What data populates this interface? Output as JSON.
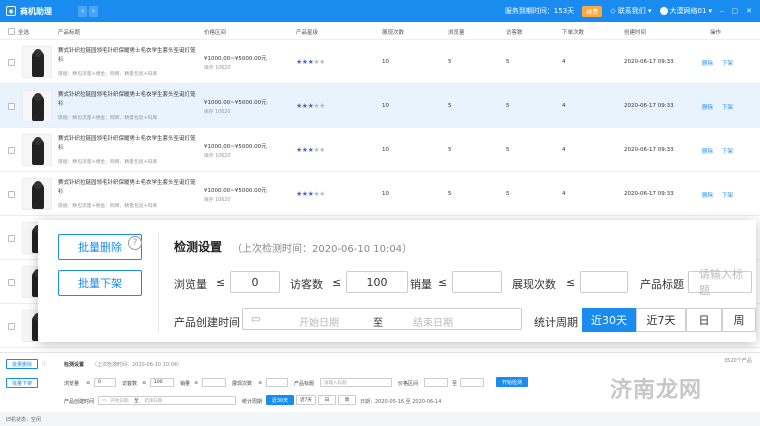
{
  "topbar": {
    "app_title": "商机助理",
    "back": "‹",
    "forward": "›",
    "expiry": "服务到期时间：153天",
    "renew": "续费",
    "contact": "联系我们",
    "user": "大漠网络01",
    "min": "–",
    "max": "▢",
    "close": "✕"
  },
  "table": {
    "headers": [
      "全选",
      "产品标题",
      "价格区间",
      "产品星级",
      "展现次数",
      "浏览量",
      "访客数",
      "下单次数",
      "创建时间",
      "操作"
    ],
    "rows": [
      {
        "title": "赛式针织拉链园领毛针织保暖男士毛衣学生套头圣诞灯笼衫",
        "sub": "旗舰：精包流量+佣金、网商、精量包退+码库",
        "price": "¥1000.00~¥5000.00元",
        "stock": "库存 10620",
        "stars": 3,
        "shows": "10",
        "views": "5",
        "visitors": "5",
        "orders": "4",
        "created": "2020-06-17 09:33",
        "del": "删除",
        "off": "下架"
      },
      {
        "title": "赛式针织拉链园领毛针织保暖男士毛衣学生套头圣诞灯笼衫",
        "sub": "旗舰：精包流量+佣金、网商、精量包退+码库",
        "price": "¥1000.00~¥5000.00元",
        "stock": "库存 10620",
        "stars": 3,
        "shows": "10",
        "views": "5",
        "visitors": "5",
        "orders": "4",
        "created": "2020-06-17 09:33",
        "del": "删除",
        "off": "下架"
      },
      {
        "title": "赛式针织拉链园领毛针织保暖男士毛衣学生套头圣诞灯笼衫",
        "sub": "旗舰：精包流量+佣金、网商、精量包退+码库",
        "price": "¥1000.00~¥5000.00元",
        "stock": "库存 10620",
        "stars": 3,
        "shows": "10",
        "views": "5",
        "visitors": "5",
        "orders": "4",
        "created": "2020-06-17 09:33",
        "del": "删除",
        "off": "下架"
      },
      {
        "title": "赛式针织拉链园领毛针织保暖男士毛衣学生套头圣诞灯笼衫",
        "sub": "旗舰：精包流量+佣金、网商、精量包退+码库",
        "price": "¥1000.00~¥5000.00元",
        "stock": "库存 10620",
        "stars": 3,
        "shows": "10",
        "views": "5",
        "visitors": "5",
        "orders": "4",
        "created": "2020-06-17 09:33",
        "del": "删除",
        "off": "下架"
      }
    ]
  },
  "zoom": {
    "batch_delete": "批量删除",
    "batch_off": "批量下架",
    "help": "?",
    "settings": "检测设置",
    "last_check": "（上次检测时间：2020-06-10 10:04）",
    "views_label": "浏览量",
    "visitors_label": "访客数",
    "sales_label": "销量",
    "shows_label": "展现次数",
    "title_label": "产品标题",
    "leq": "≤",
    "views_val": "0",
    "visitors_val": "100",
    "title_placeholder": "请输入标题",
    "created_label": "产品创建时间",
    "start_placeholder": "开始日期",
    "to": "至",
    "end_placeholder": "结束日期",
    "period_label": "统计周期",
    "periods": [
      "近30天",
      "近7天",
      "日",
      "周"
    ]
  },
  "bottom": {
    "batch_delete": "批量删除",
    "batch_off": "批量下架",
    "settings": "检测设置",
    "last_check": "（上次检测时间：2020-06-10 10:04）",
    "count": "3520个产品",
    "views_label": "浏览量",
    "visitors_label": "访客数",
    "sales_label": "销量",
    "shows_label": "展现次数",
    "title_label": "产品标题",
    "price_label": "价格区间",
    "leq": "≤",
    "zero": "0",
    "hundred": "100",
    "title_placeholder": "请输入标题",
    "to": "至",
    "start_check": "开始检测",
    "created_label": "产品创建时间",
    "start_placeholder": "开始日期",
    "end_placeholder": "结束日期",
    "period_label": "统计周期",
    "periods": [
      "近30天",
      "近7天",
      "日",
      "周"
    ],
    "date_range": "日期：2020-05-16 至 2020-06-14"
  },
  "footer": {
    "status": "旧机状态：空闲"
  },
  "watermark": "济南龙网"
}
